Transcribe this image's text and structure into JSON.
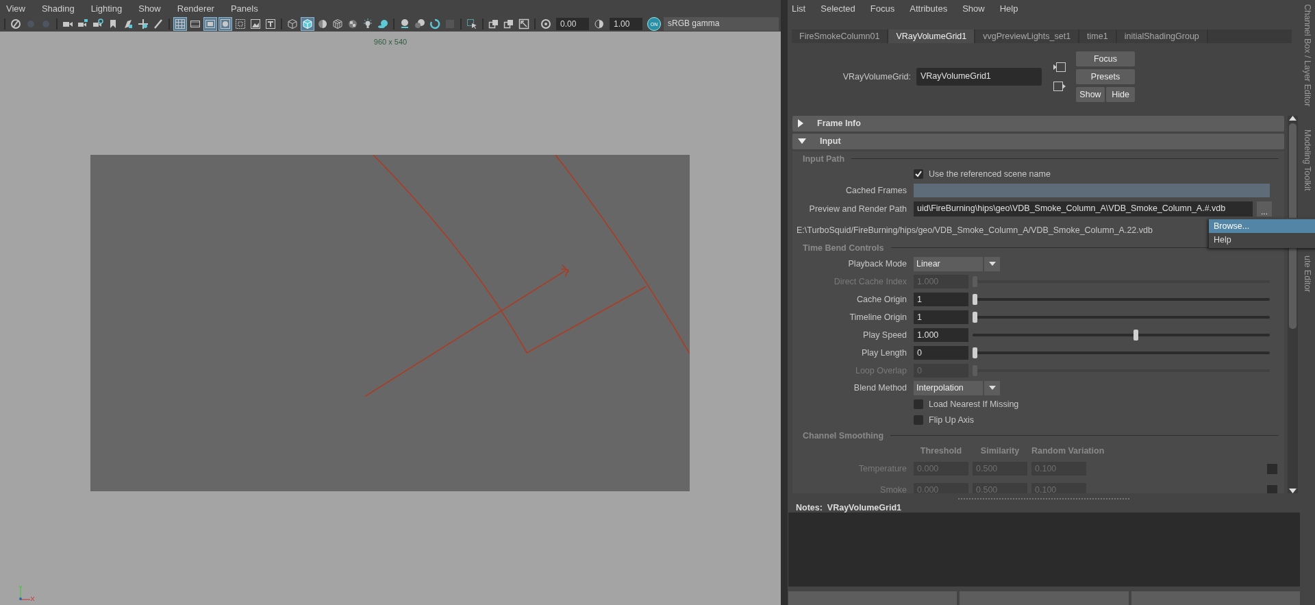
{
  "viewport": {
    "menu": [
      "View",
      "Shading",
      "Lighting",
      "Show",
      "Renderer",
      "Panels"
    ],
    "toolbar": [
      {
        "kind": "separator"
      },
      {
        "kind": "camera-select",
        "on": false
      },
      {
        "kind": "dot",
        "on": false
      },
      {
        "kind": "dot",
        "on": false
      },
      {
        "kind": "separator"
      },
      {
        "kind": "camera",
        "on": false
      },
      {
        "kind": "camera-lock",
        "on": false
      },
      {
        "kind": "camera-gear",
        "on": false
      },
      {
        "kind": "bookmark",
        "on": false
      },
      {
        "kind": "image-plane",
        "on": false
      },
      {
        "kind": "pan",
        "on": false
      },
      {
        "kind": "pencil",
        "on": false
      },
      {
        "kind": "separator"
      },
      {
        "kind": "grid",
        "on": true
      },
      {
        "kind": "film",
        "on": false
      },
      {
        "kind": "gate",
        "on": true
      },
      {
        "kind": "gate-mask",
        "on": true
      },
      {
        "kind": "field-chart",
        "on": false
      },
      {
        "kind": "safe-action",
        "on": false
      },
      {
        "kind": "safe-title",
        "on": false
      },
      {
        "kind": "separator"
      },
      {
        "kind": "wire-cube",
        "on": false
      },
      {
        "kind": "shaded-cube",
        "on": true
      },
      {
        "kind": "half-sphere",
        "on": false
      },
      {
        "kind": "textured-cube",
        "on": false
      },
      {
        "kind": "checker",
        "on": false
      },
      {
        "kind": "bulb",
        "on": false
      },
      {
        "kind": "shadow",
        "on": false
      },
      {
        "kind": "separator"
      },
      {
        "kind": "sphere",
        "on": false
      },
      {
        "kind": "sphere-dim",
        "on": false
      },
      {
        "kind": "ring",
        "on": false
      },
      {
        "kind": "square-dim",
        "on": false
      },
      {
        "kind": "separator"
      },
      {
        "kind": "select-arrow",
        "on": false
      },
      {
        "kind": "separator"
      },
      {
        "kind": "overlap",
        "on": false
      },
      {
        "kind": "overlap",
        "on": false
      },
      {
        "kind": "frame",
        "on": false
      },
      {
        "kind": "separator"
      },
      {
        "kind": "aperture",
        "on": false
      },
      {
        "kind": "field",
        "value": "0.00"
      },
      {
        "kind": "half-moon",
        "on": false
      },
      {
        "kind": "field",
        "value": "1.00"
      },
      {
        "kind": "toggle",
        "label": "ON",
        "on": true
      },
      {
        "kind": "dropdown",
        "value": "sRGB gamma"
      }
    ],
    "resolution_label": "960 x 540"
  },
  "attribute_editor": {
    "menu": [
      "List",
      "Selected",
      "Focus",
      "Attributes",
      "Show",
      "Help"
    ],
    "tabs": [
      {
        "label": "FireSmokeColumn01",
        "selected": false
      },
      {
        "label": "VRayVolumeGrid1",
        "selected": true
      },
      {
        "label": "vvgPreviewLights_set1",
        "selected": false
      },
      {
        "label": "time1",
        "selected": false
      },
      {
        "label": "initialShadingGroup",
        "selected": false
      }
    ],
    "node_label": "VRayVolumeGrid:",
    "node_name": "VRayVolumeGrid1",
    "buttons": [
      "Focus",
      "Presets",
      "Show",
      "Hide"
    ],
    "sections": [
      {
        "title": "Frame Info",
        "expanded": false
      },
      {
        "title": "Input",
        "expanded": true,
        "rows": [
          {
            "kind": "group",
            "label": "Input Path"
          },
          {
            "kind": "checkbox",
            "label": "Use the referenced scene name",
            "checked": true
          },
          {
            "kind": "field",
            "label": "Cached Frames"
          },
          {
            "kind": "path",
            "label": "Preview and Render Path",
            "value": "uid\\FireBurning\\hips\\geo\\VDB_Smoke_Column_A\\VDB_Smoke_Column_A.#.vdb",
            "button": "..."
          },
          {
            "kind": "info",
            "text": "E:\\TurboSquid/FireBurning/hips/geo/VDB_Smoke_Column_A/VDB_Smoke_Column_A.22.vdb"
          },
          {
            "kind": "group",
            "label": "Time Bend Controls"
          },
          {
            "kind": "dropdown",
            "label": "Playback Mode",
            "value": "Linear"
          },
          {
            "kind": "slider",
            "label": "Direct Cache Index",
            "value": "1.000",
            "level": 0,
            "disabled": true
          },
          {
            "kind": "slider",
            "label": "Cache Origin",
            "value": "1",
            "level": 0,
            "disabled": false
          },
          {
            "kind": "slider",
            "label": "Timeline Origin",
            "value": "1",
            "level": 0,
            "disabled": false
          },
          {
            "kind": "slider",
            "label": "Play Speed",
            "value": "1.000",
            "level": 0.55,
            "disabled": false
          },
          {
            "kind": "slider",
            "label": "Play Length",
            "value": "0",
            "level": 0,
            "disabled": false
          },
          {
            "kind": "slider",
            "label": "Loop Overlap",
            "value": "0",
            "level": 0,
            "disabled": true
          },
          {
            "kind": "dropdown",
            "label": "Blend Method",
            "value": "Interpolation"
          },
          {
            "kind": "checkbox",
            "label": "Load Nearest If Missing",
            "checked": false
          },
          {
            "kind": "checkbox",
            "label": "Flip Up Axis",
            "checked": false
          },
          {
            "kind": "group",
            "label": "Channel Smoothing"
          },
          {
            "kind": "columns",
            "labels": [
              "Threshold",
              "Similarity",
              "Random Variation"
            ]
          },
          {
            "kind": "triple",
            "label": "Temperature",
            "values": [
              "0.000",
              "0.500",
              "0.100"
            ],
            "disabled": true,
            "checked": false
          },
          {
            "kind": "triple",
            "label": "Smoke",
            "values": [
              "0.000",
              "0.500",
              "0.100"
            ],
            "disabled": true,
            "checked": false
          }
        ]
      }
    ],
    "context_menu": [
      {
        "label": "Browse...",
        "selected": true
      },
      {
        "label": "Help",
        "selected": false
      }
    ],
    "notes": "Notes:  VRayVolumeGrid1"
  },
  "side_tabs": [
    "Channel Box / Layer Editor",
    "Modeling Toolkit",
    "ute Editor"
  ]
}
